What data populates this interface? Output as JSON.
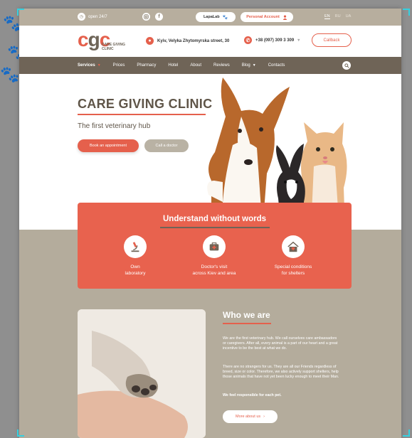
{
  "topbar": {
    "open_hours": "open 24/7",
    "lapalab_label": "LapaLab",
    "account_label": "Personal Account",
    "languages": [
      "EN",
      "RU",
      "UA"
    ]
  },
  "header": {
    "logo_mark": "cgc",
    "logo_name_line1": "CARE GIVING",
    "logo_name_line2": "CLINIC",
    "address": "Kyiv, Velyka Zhytomyrska street, 30",
    "phone": "+38 (097) 309 3 309",
    "callback_label": "Callback"
  },
  "nav": {
    "items": [
      {
        "label": "Services",
        "arrow": true
      },
      {
        "label": "Prices"
      },
      {
        "label": "Pharmacy"
      },
      {
        "label": "Hotel"
      },
      {
        "label": "About"
      },
      {
        "label": "Reviews"
      },
      {
        "label": "Blog",
        "arrow": true
      },
      {
        "label": "Contacts"
      }
    ]
  },
  "hero": {
    "title": "CARE GIVING CLINIC",
    "subtitle": "The first veterinary hub",
    "appointment_label": "Book an appointment",
    "call_doctor_label": "Call a doctor"
  },
  "understand": {
    "title": "Understand without words",
    "features": [
      {
        "line1": "Own",
        "line2": "laboratory",
        "icon": "microscope-icon"
      },
      {
        "line1": "Doctor's visit",
        "line2": "across Kiev and area",
        "icon": "medical-case-icon"
      },
      {
        "line1": "Special conditions",
        "line2": "for shelters",
        "icon": "shelter-house-icon"
      }
    ]
  },
  "who": {
    "title": "Who we are",
    "p1": "We are the first veterinary hub. We call ourselves care ambassadors or caregivers. After all, every animal is a part of our heart and a great incentive to be the best at what we do.",
    "p2": "There are no strangers for us. They are all our Friends regardless of breed, size or color. Therefore, we also actively support shelters, help those animals that have not yet been lucky enough to meet their Man.",
    "p3": "We feel responsible for each pet.",
    "more_label": "More about us"
  },
  "colors": {
    "accent": "#e5604c",
    "nav_bg": "#6f6457",
    "section_bg": "#b4ac9c"
  }
}
